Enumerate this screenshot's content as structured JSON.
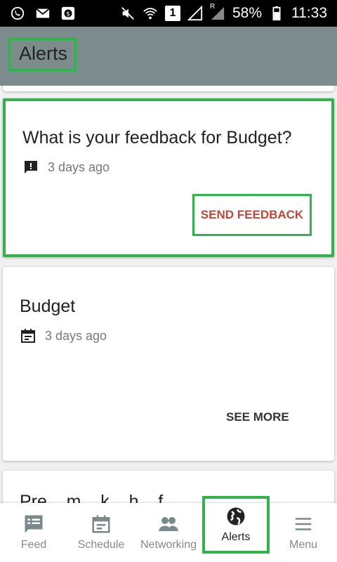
{
  "status_bar": {
    "battery": "58%",
    "time": "11:33",
    "sim_number": "1",
    "roaming": "R"
  },
  "header": {
    "title": "Alerts"
  },
  "alerts": [
    {
      "title": "What is your feedback for Budget?",
      "meta_icon": "feedback-icon",
      "time": "3 days ago",
      "action_label": "SEND FEEDBACK"
    },
    {
      "title": "Budget",
      "meta_icon": "calendar-icon",
      "time": "3 days ago",
      "action_label": "SEE MORE"
    },
    {
      "title": "Pre... m... k... h... f..."
    }
  ],
  "bottom_nav": [
    {
      "label": "Feed",
      "icon": "feed-icon"
    },
    {
      "label": "Schedule",
      "icon": "schedule-icon"
    },
    {
      "label": "Networking",
      "icon": "networking-icon"
    },
    {
      "label": "Alerts",
      "icon": "globe-icon",
      "active": true
    },
    {
      "label": "Menu",
      "icon": "menu-icon"
    }
  ],
  "colors": {
    "app_bar": "#7c8c8c",
    "accent_red": "#c0473a",
    "highlight_green": "#2fb34a"
  }
}
